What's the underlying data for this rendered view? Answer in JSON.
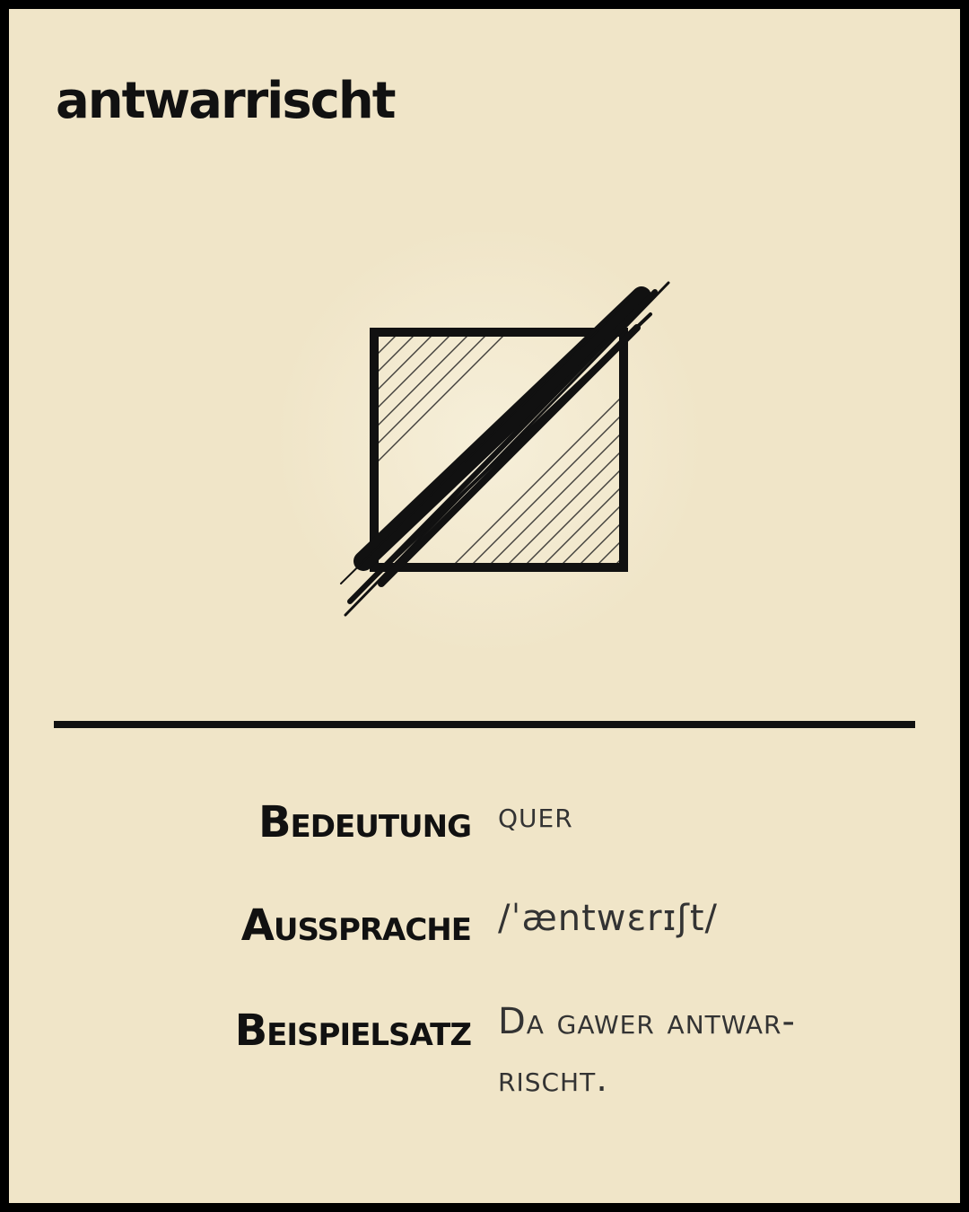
{
  "colors": {
    "background": "#F0E5C8",
    "border": "#000000",
    "ink": "#111111",
    "value_text": "#333333"
  },
  "entry": {
    "headword": "antwarrischt",
    "illustration_icon": "crossed-square-sketch-icon"
  },
  "details": [
    {
      "label": "Bedeutung",
      "value": "quer"
    },
    {
      "label": "Aussprache",
      "value": "/ˈæntwɛrɪʃt/"
    },
    {
      "label": "Beispielsatz",
      "value": "Da gawer antwar-rischt."
    }
  ]
}
